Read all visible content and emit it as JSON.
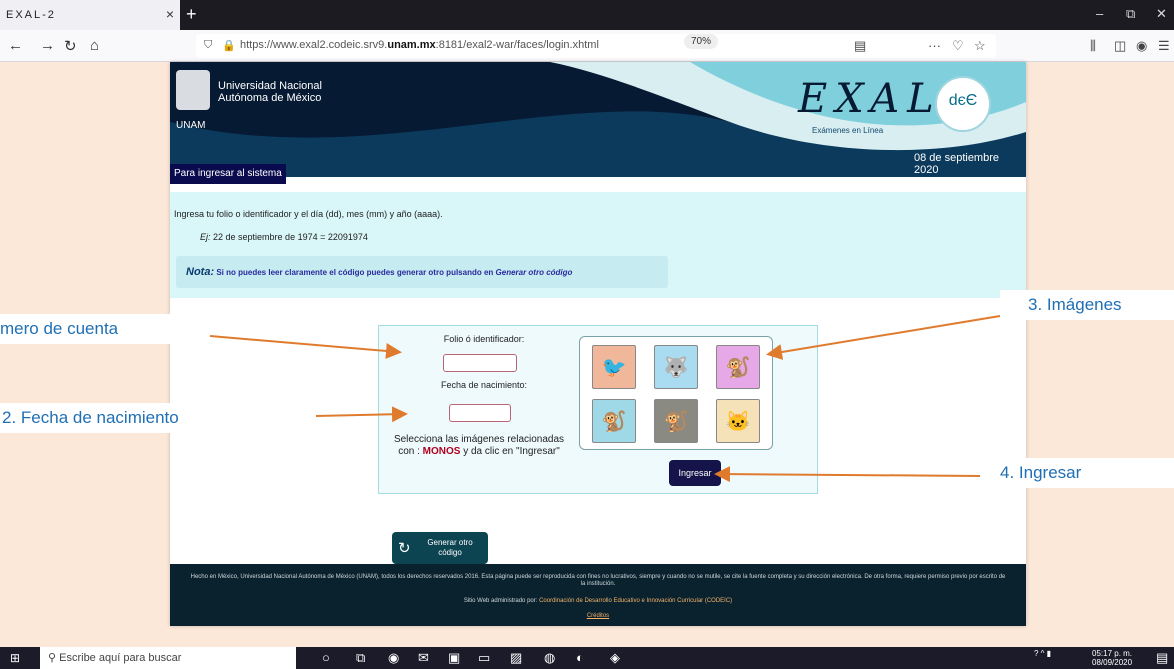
{
  "browser": {
    "tab_title": "EXAL-2",
    "tab_close": "×",
    "new_tab": "+",
    "url_prefix": "https://www.exal2.codeic.srv9.",
    "url_domain": "unam.mx",
    "url_suffix": ":8181/exal2-war/faces/login.xhtml",
    "zoom": "70%"
  },
  "banner": {
    "unam_name_line1": "Universidad Nacional",
    "unam_name_line2": "Autónoma de México",
    "unam_label": "UNAM",
    "exal_logo": "EXAL",
    "exal_sub": "Exámenes en Línea",
    "dee_logo": "dєЄ",
    "date": "08 de septiembre 2020"
  },
  "section_title": "Para ingresar al sistema",
  "info": {
    "line1": "Ingresa tu folio o identificador y el día (dd), mes (mm) y año (aaaa).",
    "example_label": "Ej:",
    "example_text": " 22 de septiembre de 1974 = 22091974",
    "nota_label": "Nota:",
    "nota_text": " Si no puedes leer claramente el código puedes generar otro pulsando en ",
    "nota_link": "Generar otro código"
  },
  "form": {
    "folio_label": "Folio ó identificador:",
    "folio_value": "",
    "fecha_label": "Fecha de nacimiento:",
    "fecha_value": "",
    "instr_prefix": "Selecciona las imágenes relacionadas con : ",
    "instr_keyword": "MONOS",
    "instr_suffix": " y da clic en \"Ingresar\"",
    "ingresar": "Ingresar"
  },
  "animals": [
    {
      "name": "bird",
      "glyph": "🐦",
      "bg": "#f0b79a"
    },
    {
      "name": "wolf",
      "glyph": "🐺",
      "bg": "#a9dcf0"
    },
    {
      "name": "monkey",
      "glyph": "🐒",
      "bg": "#e6a8e6"
    },
    {
      "name": "monkey-hanging",
      "glyph": "🐒",
      "bg": "#9fd8e6"
    },
    {
      "name": "monkey-sitting",
      "glyph": "🐒",
      "bg": "#8a8a82"
    },
    {
      "name": "cat",
      "glyph": "🐱",
      "bg": "#f6e2b8"
    }
  ],
  "regenerate": {
    "line1": "Generar otro",
    "line2": "código"
  },
  "footer": {
    "line1": "Hecho en México, Universidad Nacional Autónoma de México (UNAM), todos los derechos reservados 2016. Esta página puede ser reproducida con fines no lucrativos, siempre y cuando no se mutile, se cite la fuente completa y su dirección electrónica. De otra forma, requiere permiso previo por escrito de la institución.",
    "line2_prefix": "Sitio Web administrado por: ",
    "line2_link": "Coordinación de Desarrollo Educativo e Innovación Curricular (CODEIC)",
    "creditos": "Créditos"
  },
  "annotations": {
    "a1": "mero de cuenta",
    "a2": "2. Fecha de nacimiento",
    "a3": "3. Imágenes",
    "a4": "4. Ingresar"
  },
  "taskbar": {
    "search": "Escribe aquí para buscar",
    "time": "05:17 p. m.",
    "date": "08/09/2020"
  }
}
